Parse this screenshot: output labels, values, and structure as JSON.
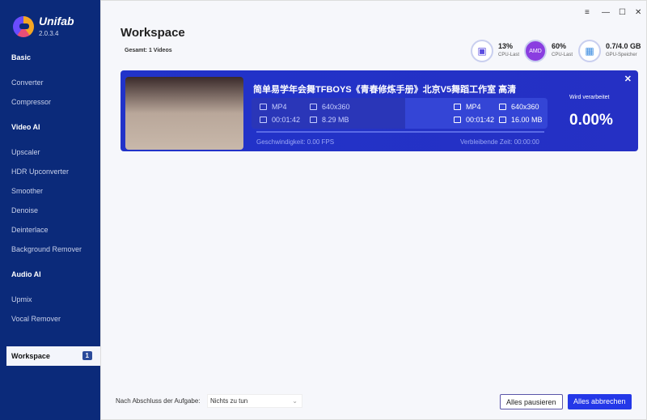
{
  "app": {
    "name": "Unifab",
    "version": "2.0.3.4"
  },
  "sidebar": {
    "sections": [
      {
        "label": "Basic",
        "items": [
          "Converter",
          "Compressor"
        ]
      },
      {
        "label": "Video AI",
        "items": [
          "Upscaler",
          "HDR Upconverter",
          "Smoother",
          "Denoise",
          "Deinterlace",
          "Background Remover"
        ]
      },
      {
        "label": "Audio AI",
        "items": [
          "Upmix",
          "Vocal Remover"
        ]
      }
    ],
    "workspace": {
      "label": "Workspace",
      "badge": "1"
    }
  },
  "window": {
    "menu": "≡",
    "minimize": "—",
    "maximize": "☐",
    "close": "✕"
  },
  "header": {
    "title": "Workspace",
    "total": "Gesamt: 1 Videos"
  },
  "stats": [
    {
      "value": "13%",
      "label": "CPU-Last",
      "icon": "cpu-icon"
    },
    {
      "value": "60%",
      "label": "CPU-Last",
      "icon": "amd-icon"
    },
    {
      "value": "0.7/4.0 GB",
      "label": "GPU-Speicher",
      "icon": "gpu-icon"
    }
  ],
  "task": {
    "title": "简单易学年会舞TFBOYS《青春修炼手册》北京V5舞蹈工作室 高清",
    "source": {
      "format": "MP4",
      "resolution": "640x360",
      "duration": "00:01:42",
      "size": "8.29 MB"
    },
    "output": {
      "format": "MP4",
      "resolution": "640x360",
      "duration": "00:01:42",
      "size": "16.00 MB"
    },
    "speed": "Geschwindigkeit: 0.00  FPS",
    "remaining": "Verbleibende Zeit: 00:00:00",
    "status": "Wird verarbeitet",
    "progress": "0.00%",
    "close": "✕"
  },
  "footer": {
    "after_label": "Nach Abschluss der Aufgabe:",
    "after_value": "Nichts zu tun",
    "pause": "Alles pausieren",
    "abort": "Alles abbrechen"
  },
  "colors": {
    "sidebar": "#0b2a7a",
    "card": "#2133c9",
    "accent": "#2438e8"
  }
}
